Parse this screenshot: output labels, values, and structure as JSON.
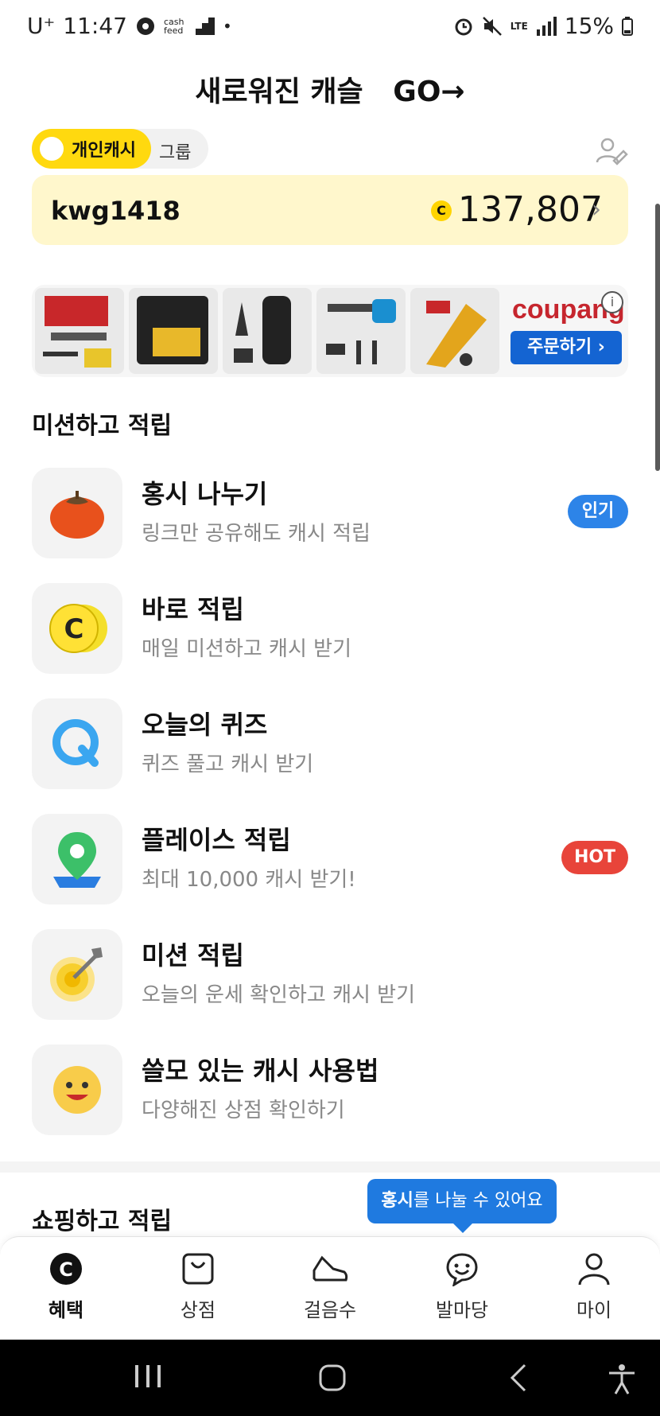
{
  "status_bar": {
    "carrier": "U⁺",
    "time": "11:47",
    "app_badge": "cash feed",
    "network": "LTE",
    "battery": "15%"
  },
  "header": {
    "title": "새로워진 캐슬",
    "go_label": "GO→"
  },
  "toggle": {
    "personal": "개인캐시",
    "group": "그룹"
  },
  "cash": {
    "user_id": "kwg1418",
    "coin_symbol": "C",
    "amount": "137,807",
    "chevron": "›"
  },
  "ad": {
    "brand": "coupang",
    "order_label": "주문하기 ›",
    "info": "i"
  },
  "missions_section": {
    "title": "미션하고 적립",
    "items": [
      {
        "title": "홍시 나누기",
        "sub": "링크만 공유해도 캐시 적립",
        "icon": "persimmon-icon",
        "badge": "인기",
        "badge_color": "#2d84e8"
      },
      {
        "title": "바로 적립",
        "sub": "매일 미션하고 캐시 받기",
        "icon": "coin-icon"
      },
      {
        "title": "오늘의 퀴즈",
        "sub": "퀴즈 풀고 캐시 받기",
        "icon": "quiz-icon"
      },
      {
        "title": "플레이스 적립",
        "sub": "최대 10,000 캐시 받기!",
        "icon": "map-pin-icon",
        "badge": "HOT",
        "badge_color": "#e8443a"
      },
      {
        "title": "미션 적립",
        "sub": "오늘의 운세 확인하고 캐시 받기",
        "icon": "target-icon"
      },
      {
        "title": "쓸모 있는 캐시 사용법",
        "sub": "다양해진 상점 확인하기",
        "icon": "smile-icon"
      }
    ]
  },
  "shopping_section": {
    "title": "쇼핑하고 적립"
  },
  "tooltip": {
    "bold": "홍시",
    "rest": "를 나눌 수 있어요"
  },
  "bottom_nav": [
    {
      "label": "혜택",
      "icon": "benefit-coin-icon",
      "active": true
    },
    {
      "label": "상점",
      "icon": "shopping-bag-icon"
    },
    {
      "label": "걸음수",
      "icon": "sneaker-icon"
    },
    {
      "label": "발마당",
      "icon": "chat-smile-icon"
    },
    {
      "label": "마이",
      "icon": "person-icon"
    }
  ],
  "colors": {
    "accent_yellow": "#ffd90f",
    "card_bg": "#fff7cc",
    "blue": "#1f7ae0",
    "hot_red": "#e8443a"
  }
}
